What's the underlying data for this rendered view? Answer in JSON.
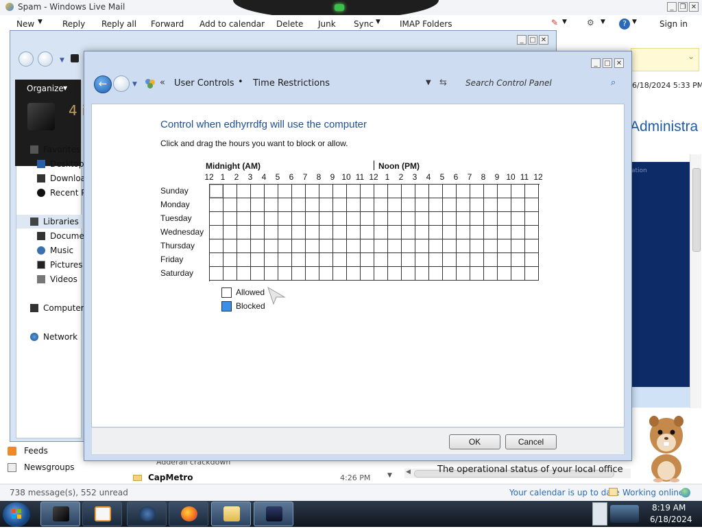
{
  "wlm": {
    "title": "Spam - Windows Live Mail",
    "commands": [
      "New",
      "Reply",
      "Reply all",
      "Forward",
      "Add to calendar",
      "Delete",
      "Junk",
      "Sync",
      "IMAP Folders"
    ],
    "sign_in": "Sign in",
    "date": "6/18/2024 5:33 PM",
    "admin_heading": "Administra",
    "feeds": "Feeds",
    "newsgroups": "Newsgroups",
    "partial_subject": "Adderall crackdown",
    "capmetro": "CapMetro",
    "capmetro_time": "4:26 PM",
    "operational": "The operational status of your local office",
    "status_left": "738 message(s), 552 unread",
    "status_calendar": "Your calendar is up to date",
    "status_online": "Working online",
    "navy_text": "ation"
  },
  "explorer": {
    "organize": "Organize",
    "count": "4 i",
    "nav": {
      "favorites": "Favorites",
      "desktop": "Desktop",
      "downloads": "Downloa",
      "recent": "Recent Pl",
      "libraries": "Libraries",
      "documents": "Documen",
      "music": "Music",
      "pictures": "Pictures",
      "videos": "Videos",
      "computer": "Computer",
      "network": "Network"
    }
  },
  "dialog": {
    "breadcrumb": [
      "User Controls",
      "Time Restrictions"
    ],
    "search_placeholder": "Search Control Panel",
    "heading": "Control when edhyrrdfg will use the computer",
    "instruction": "Click and drag the hours you want to block or allow.",
    "am_label": "Midnight (AM)",
    "pm_label": "Noon (PM)",
    "hours": [
      "12",
      "1",
      "2",
      "3",
      "4",
      "5",
      "6",
      "7",
      "8",
      "9",
      "10",
      "11",
      "12",
      "1",
      "2",
      "3",
      "4",
      "5",
      "6",
      "7",
      "8",
      "9",
      "10",
      "11",
      "12"
    ],
    "days": [
      "Sunday",
      "Monday",
      "Tuesday",
      "Wednesday",
      "Thursday",
      "Friday",
      "Saturday"
    ],
    "legend_allowed": "Allowed",
    "legend_blocked": "Blocked",
    "ok": "OK",
    "cancel": "Cancel",
    "blocked_color": "#3b8fe8"
  },
  "taskbar": {
    "time": "8:19 AM",
    "date": "6/18/2024"
  }
}
